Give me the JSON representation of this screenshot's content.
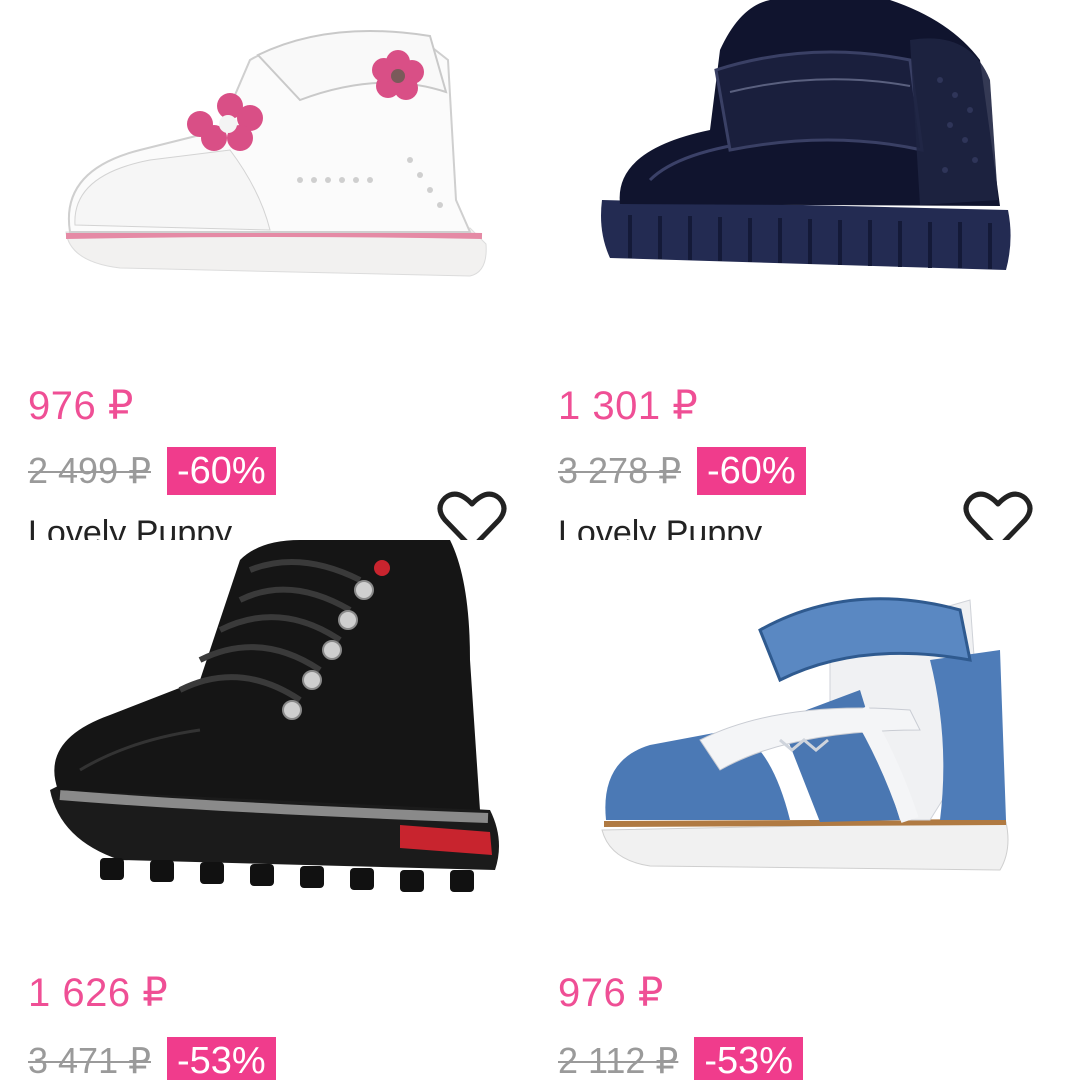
{
  "products": [
    {
      "price": "976 ₽",
      "old_price": "2 499 ₽",
      "discount": "-60%",
      "brand": "Lovely Puppy",
      "image_icon": "white-pink-baby-shoe"
    },
    {
      "price": "1 301 ₽",
      "old_price": "3 278 ₽",
      "discount": "-60%",
      "brand": "Lovely Puppy",
      "image_icon": "navy-patent-boot"
    },
    {
      "price": "1 626 ₽",
      "old_price": "3 471 ₽",
      "discount": "-53%",
      "image_icon": "black-lace-up-boot"
    },
    {
      "price": "976 ₽",
      "old_price": "2 112 ₽",
      "discount": "-53%",
      "image_icon": "blue-white-sandal"
    }
  ],
  "colors": {
    "price": "#ef4f95",
    "discount_bg": "#f03c8c",
    "old_price": "#9a9a9a"
  }
}
